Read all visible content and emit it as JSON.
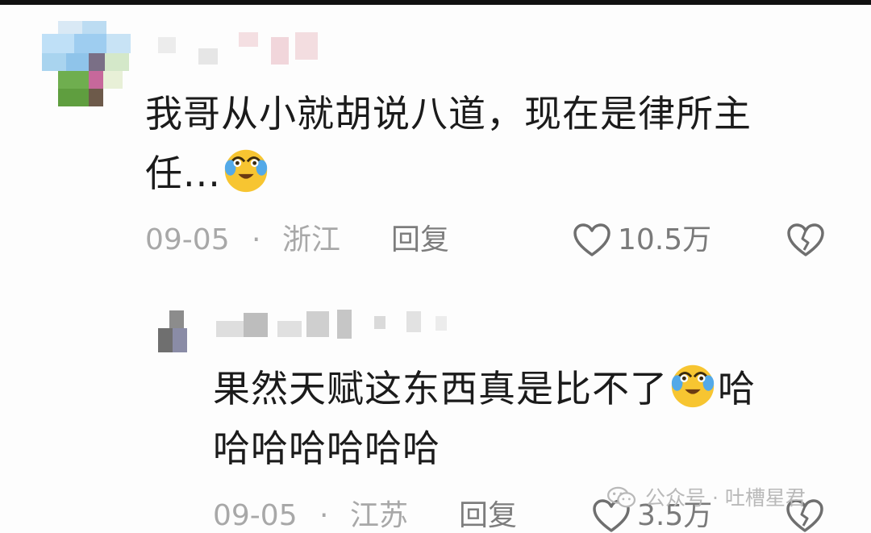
{
  "comments": [
    {
      "text_line1": "我哥从小就胡说八道，现在是律所主",
      "text_line2": "任...",
      "date": "09-05",
      "location": "浙江",
      "reply_label": "回复",
      "like_count": "10.5万"
    },
    {
      "text_line1": "果然天赋这东西真是比不了",
      "text_line1_end": "哈",
      "text_line2": "哈哈哈哈哈哈",
      "date": "09-05",
      "location": "江苏",
      "reply_label": "回复",
      "like_count": "3.5万"
    }
  ],
  "separator": "·",
  "watermark": {
    "text": "公众号 · 吐槽星君",
    "icon": "wechat-icon"
  },
  "icons": {
    "like": "heart-outline-icon",
    "dislike": "broken-heart-icon",
    "emoji": "crying-laughing-emoji"
  },
  "colors": {
    "text": "#1b1b1b",
    "meta": "#a8a8a8",
    "emoji_face": "#f7c531",
    "tears": "#53a9e8"
  }
}
